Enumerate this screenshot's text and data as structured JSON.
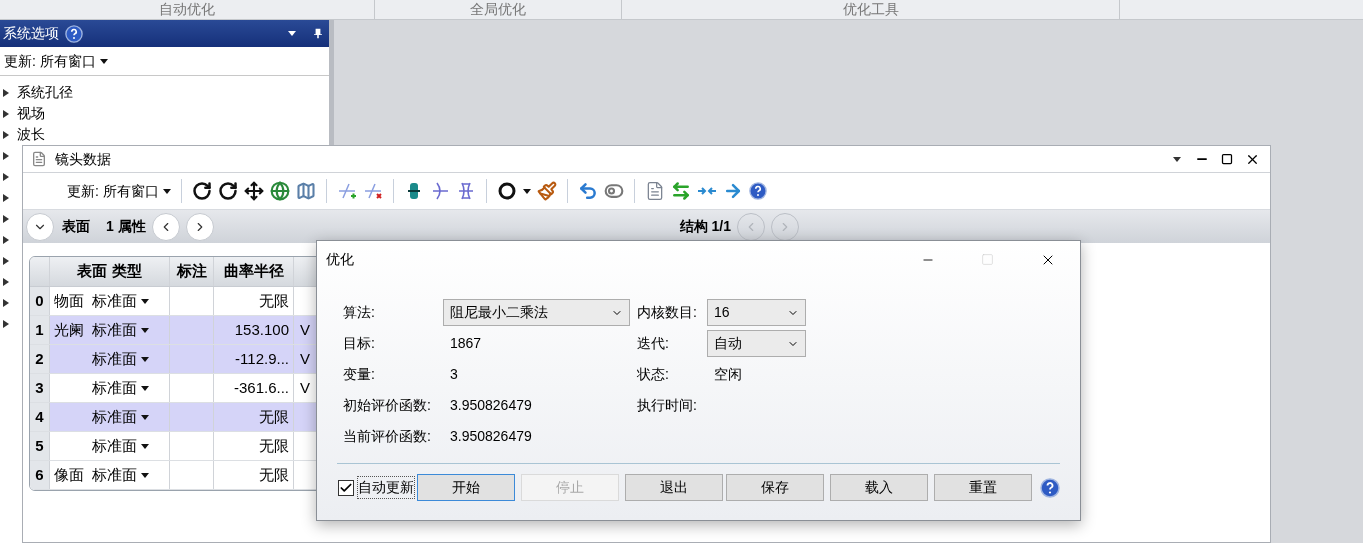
{
  "ribbon": {
    "tabs": [
      {
        "label": "自动优化"
      },
      {
        "label": "全局优化"
      },
      {
        "label": "优化工具"
      }
    ]
  },
  "system_panel": {
    "title": "系统选项",
    "update_menu": "更新: 所有窗口",
    "items": [
      {
        "label": "系统孔径",
        "expanded": false
      },
      {
        "label": "视场",
        "expanded": false
      },
      {
        "label": "波长",
        "expanded": false
      },
      {
        "expanded": false
      },
      {
        "expanded": false
      },
      {
        "expanded": false
      },
      {
        "expanded": false
      },
      {
        "expanded": false
      },
      {
        "expanded": false
      },
      {
        "expanded": false
      },
      {
        "expanded": false
      },
      {
        "expanded": false
      }
    ]
  },
  "lens_window": {
    "title": "镜头数据",
    "update_menu": "更新: 所有窗口",
    "nav": {
      "surface": "表面",
      "property": "1 属性",
      "config": "结构 1/1"
    },
    "table": {
      "columns": [
        "表面 类型",
        "标注",
        "曲率半径"
      ],
      "rows": [
        {
          "index": "0",
          "name": "物面",
          "type": "标准面",
          "radius": "无限",
          "solve": "",
          "selected": false
        },
        {
          "index": "1",
          "name": "光阑",
          "type": "标准面",
          "radius": "153.100",
          "solve": "V",
          "selected": true
        },
        {
          "index": "2",
          "name": "",
          "type": "标准面",
          "radius": "-112.9...",
          "solve": "V",
          "selected": true
        },
        {
          "index": "3",
          "name": "",
          "type": "标准面",
          "radius": "-361.6...",
          "solve": "V",
          "selected": false
        },
        {
          "index": "4",
          "name": "",
          "type": "标准面",
          "radius": "无限",
          "solve": "",
          "selected": true
        },
        {
          "index": "5",
          "name": "",
          "type": "标准面",
          "radius": "无限",
          "solve": "",
          "selected": false
        },
        {
          "index": "6",
          "name": "像面",
          "type": "标准面",
          "radius": "无限",
          "solve": "",
          "selected": false
        }
      ]
    }
  },
  "dialog": {
    "title": "优化",
    "rows": [
      {
        "left": {
          "label": "算法:",
          "value": "阻尼最小二乘法",
          "kind": "dropdown"
        },
        "right": {
          "label": "内核数目:",
          "value": "16",
          "kind": "dropdown"
        }
      },
      {
        "left": {
          "label": "目标:",
          "value": "1867",
          "kind": "text"
        },
        "right": {
          "label": "迭代:",
          "value": "自动",
          "kind": "dropdown"
        }
      },
      {
        "left": {
          "label": "变量:",
          "value": "3",
          "kind": "text"
        },
        "right": {
          "label": "状态:",
          "value": "空闲",
          "kind": "text"
        }
      },
      {
        "left": {
          "label": "初始评价函数:",
          "value": "3.950826479",
          "kind": "text"
        },
        "right": {
          "label": "执行时间:",
          "kind": "text"
        }
      },
      {
        "left": {
          "label": "当前评价函数:",
          "value": "3.950826479",
          "kind": "text"
        }
      }
    ],
    "auto_update": {
      "label": "自动更新",
      "checked": true
    },
    "left_buttons": [
      {
        "label": "开始",
        "disabled": false,
        "focused": true
      },
      {
        "label": "停止",
        "disabled": true,
        "focused": false
      },
      {
        "label": "退出",
        "disabled": false,
        "focused": false
      }
    ],
    "right_buttons": [
      {
        "label": "保存",
        "disabled": false,
        "focused": false
      },
      {
        "label": "载入",
        "disabled": false,
        "focused": false
      },
      {
        "label": "重置",
        "disabled": false,
        "focused": false
      }
    ]
  }
}
